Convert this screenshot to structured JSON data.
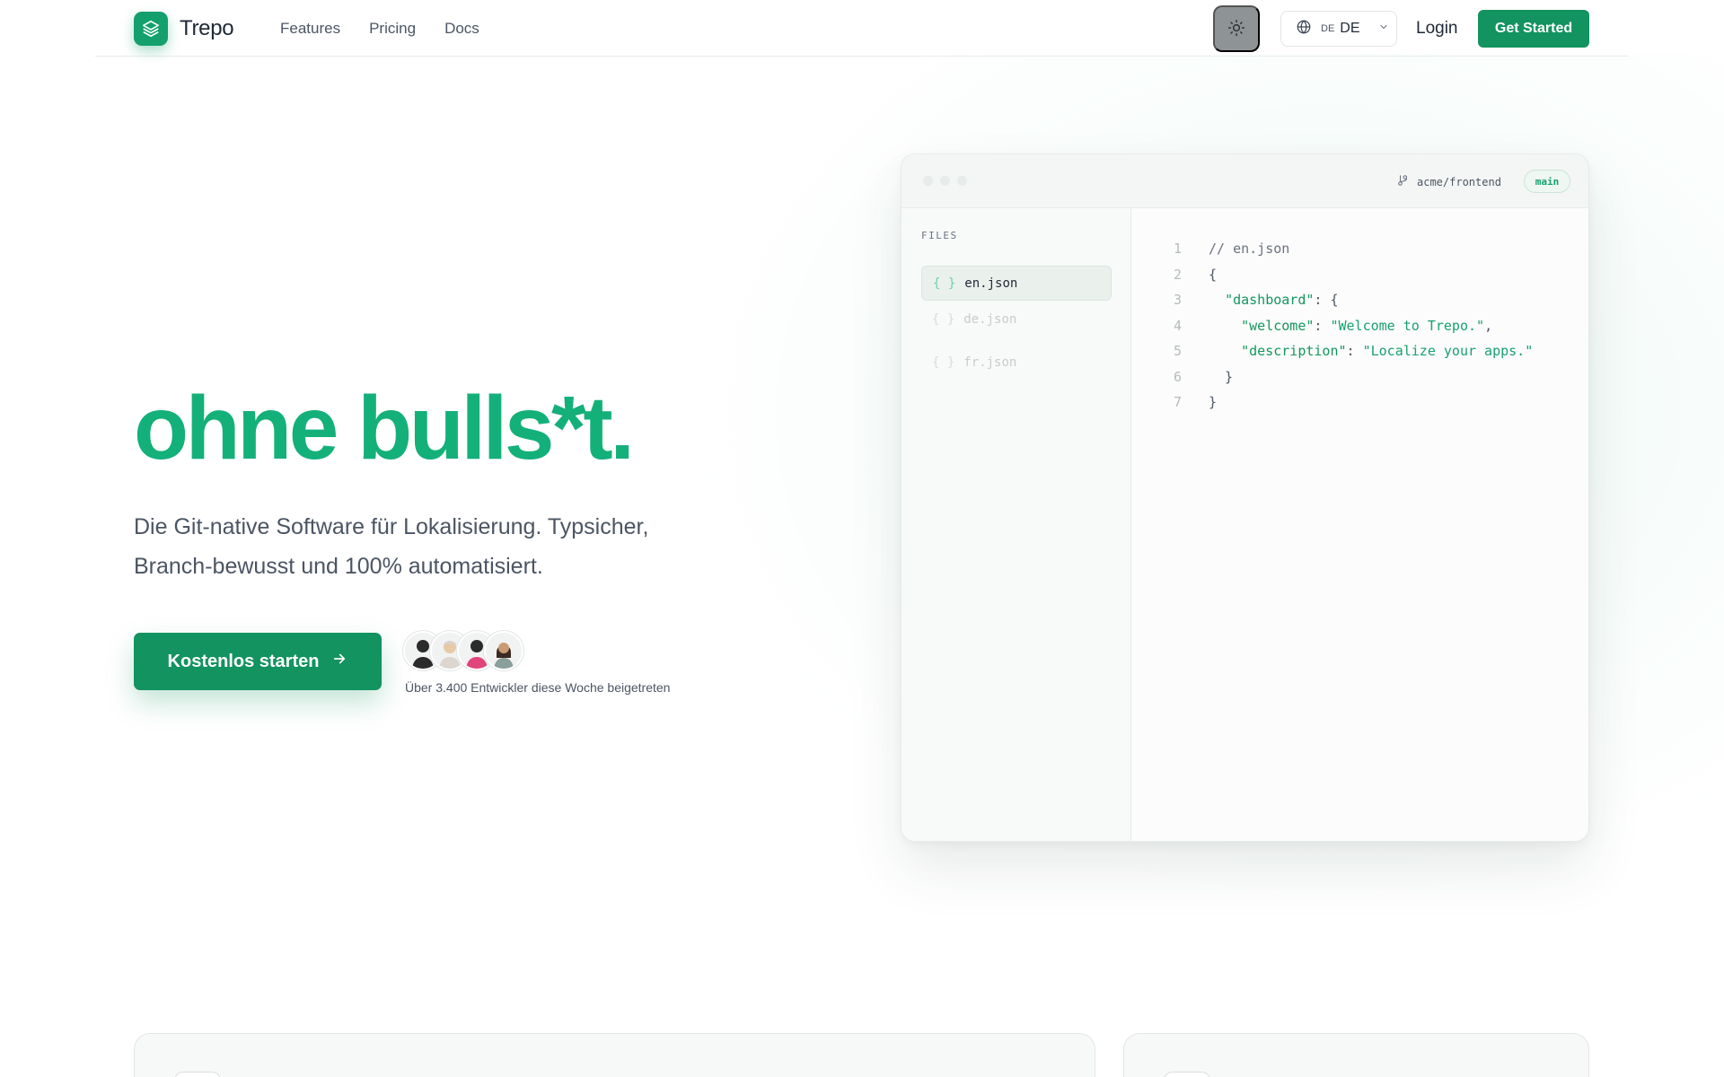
{
  "nav": {
    "brand": "Trepo",
    "links": [
      "Features",
      "Pricing",
      "Docs"
    ],
    "language_code": "DE",
    "language_label": "DE",
    "login": "Login",
    "cta": "Get Started"
  },
  "hero": {
    "title": "ohne bulls*t.",
    "subtitle_line1": "Die Git-native Software für Lokalisierung. Typsicher,",
    "subtitle_line2": "Branch-bewusst und 100% automatisiert.",
    "cta": "Kostenlos starten",
    "social_proof": "Über 3.400 Entwickler diese Woche beigetreten"
  },
  "editor": {
    "repo": "acme/frontend",
    "branch": "main",
    "files_label": "FILES",
    "files": [
      {
        "brace": "{ }",
        "name": "en.json",
        "active": true
      },
      {
        "brace": "{ }",
        "name": "de.json",
        "active": false
      },
      {
        "brace": "{ }",
        "name": "fr.json",
        "active": false
      }
    ],
    "line_numbers": [
      "1",
      "2",
      "3",
      "4",
      "5",
      "6",
      "7"
    ],
    "code": {
      "l1": "// en.json",
      "l2": "{",
      "l3_key": "\"dashboard\"",
      "l3_rest": ": {",
      "l4_key": "\"welcome\"",
      "l4_sep": ": ",
      "l4_val": "\"Welcome to Trepo.\"",
      "l4_end": ",",
      "l5_key": "\"description\"",
      "l5_sep": ": ",
      "l5_val": "\"Localize your apps.\"",
      "l6": "  }",
      "l7": "}"
    }
  },
  "colors": {
    "brand": "#14a06d",
    "brand_dark": "#12935f",
    "hero_title": "#14b07a",
    "text": "#1f2937",
    "muted": "#4b5563"
  },
  "icons": {
    "logo": "layers-icon",
    "theme": "sun-icon",
    "language": "globe-icon",
    "dropdown": "chevron-down-icon",
    "cta_arrow": "arrow-right-icon",
    "repo": "git-icon"
  }
}
